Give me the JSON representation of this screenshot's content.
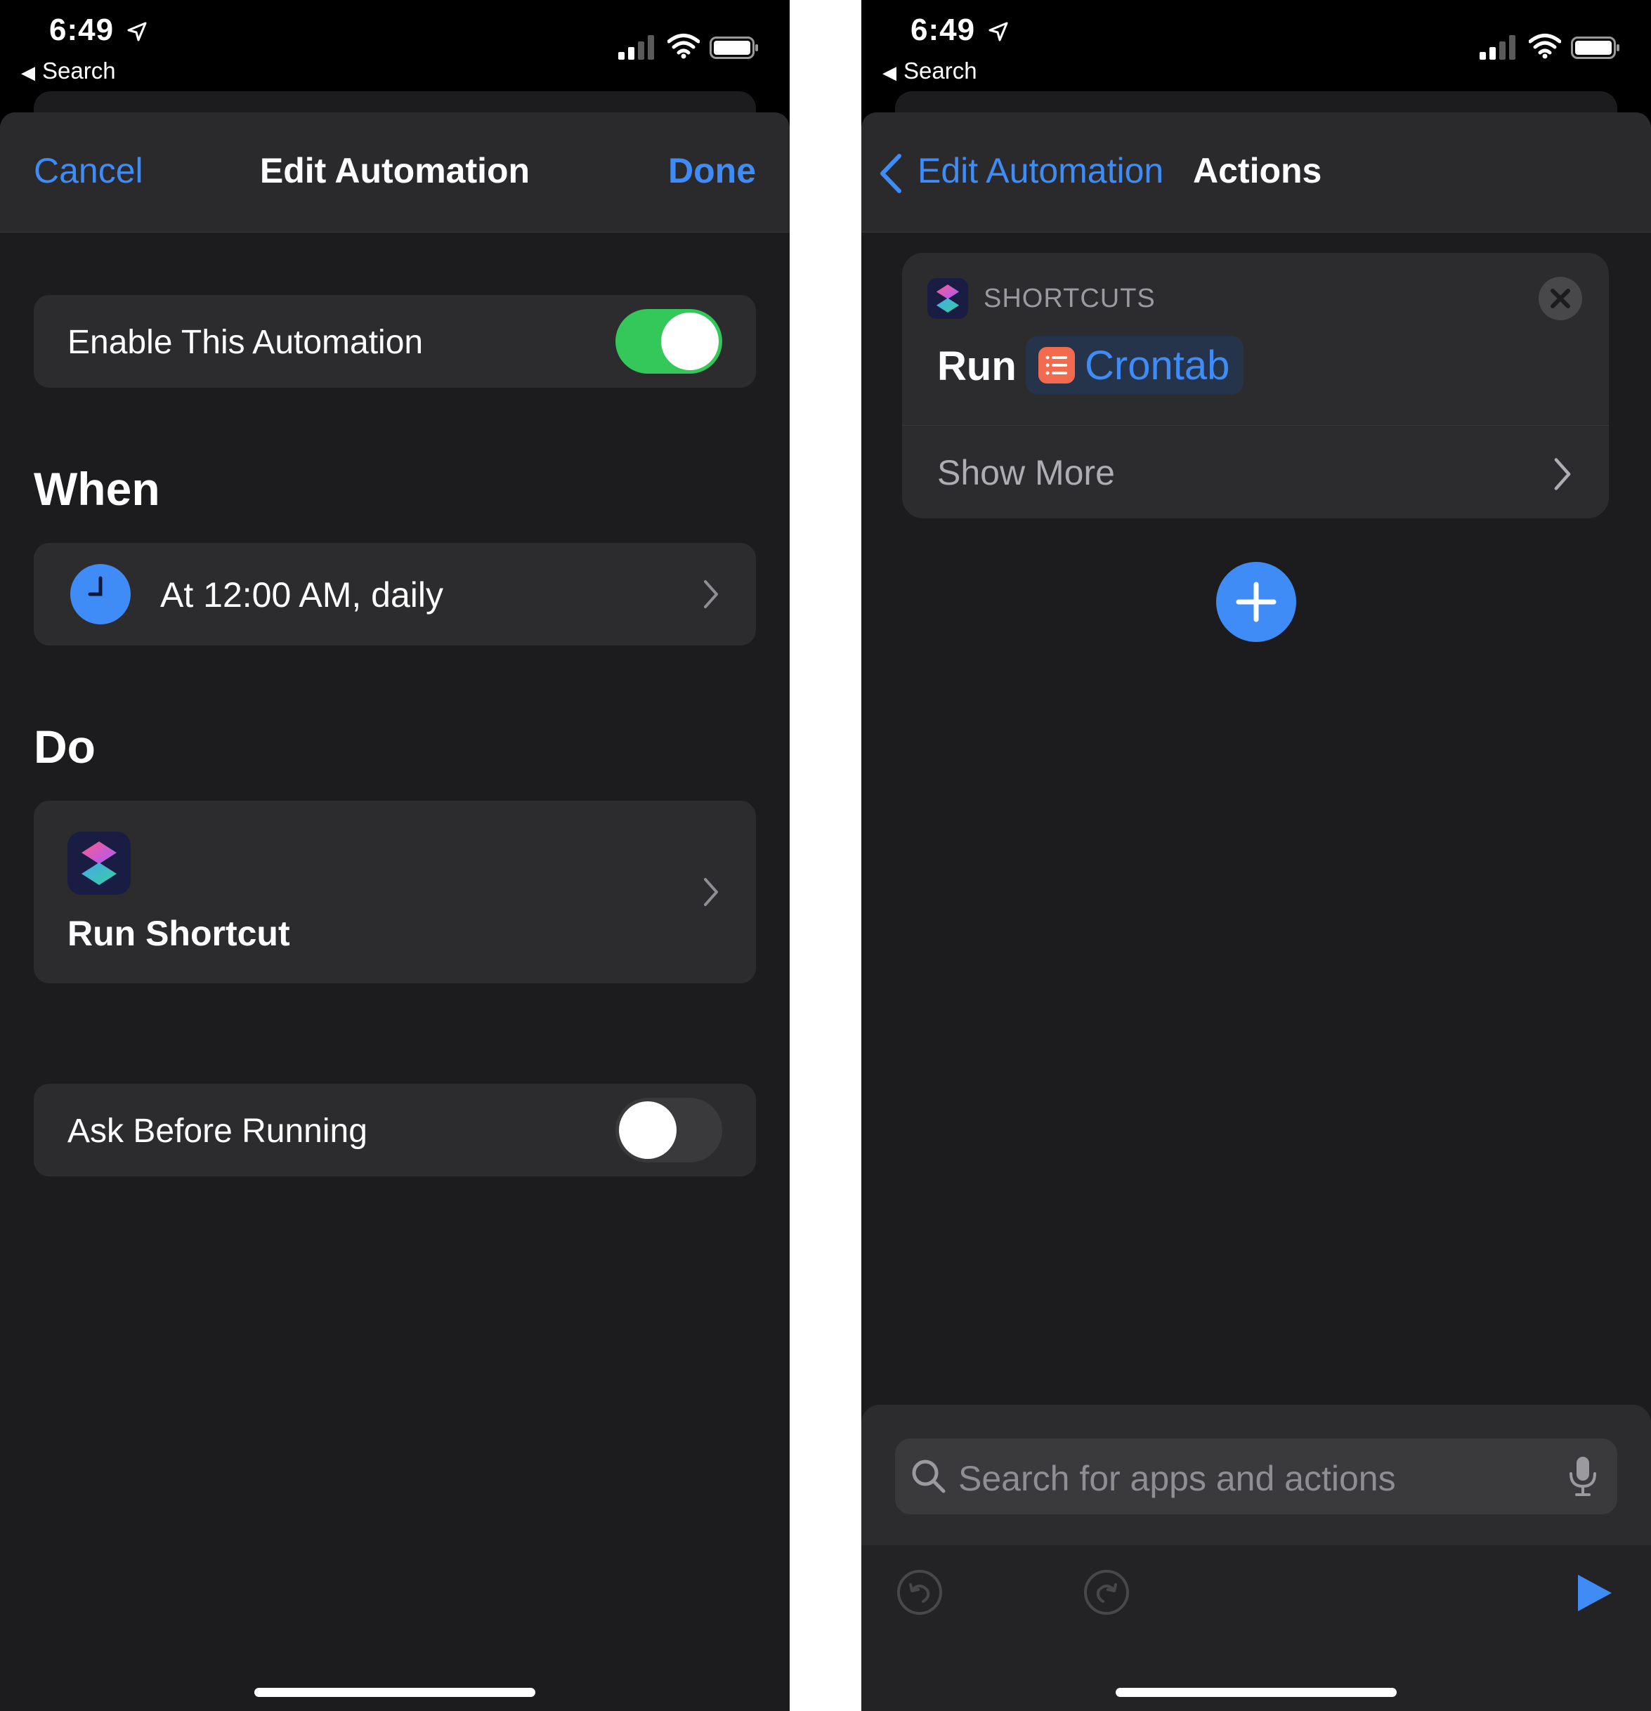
{
  "status": {
    "time": "6:49",
    "back_label": "Search"
  },
  "left": {
    "nav": {
      "cancel": "Cancel",
      "title": "Edit Automation",
      "done": "Done"
    },
    "enable": {
      "label": "Enable This Automation",
      "on": true
    },
    "when": {
      "header": "When",
      "trigger": "At 12:00 AM, daily"
    },
    "do": {
      "header": "Do",
      "action": "Run Shortcut"
    },
    "ask": {
      "label": "Ask Before Running",
      "on": false
    }
  },
  "right": {
    "nav": {
      "back": "Edit Automation",
      "title": "Actions"
    },
    "action_card": {
      "category": "SHORTCUTS",
      "verb": "Run",
      "shortcut_name": "Crontab",
      "show_more": "Show More"
    },
    "search": {
      "placeholder": "Search for apps and actions"
    }
  },
  "colors": {
    "accent": "#3f8cf7",
    "toggle_on": "#34c759",
    "crontab_icon": "#f26b4f",
    "background": "#1c1c1e",
    "card": "#2c2c2e"
  }
}
